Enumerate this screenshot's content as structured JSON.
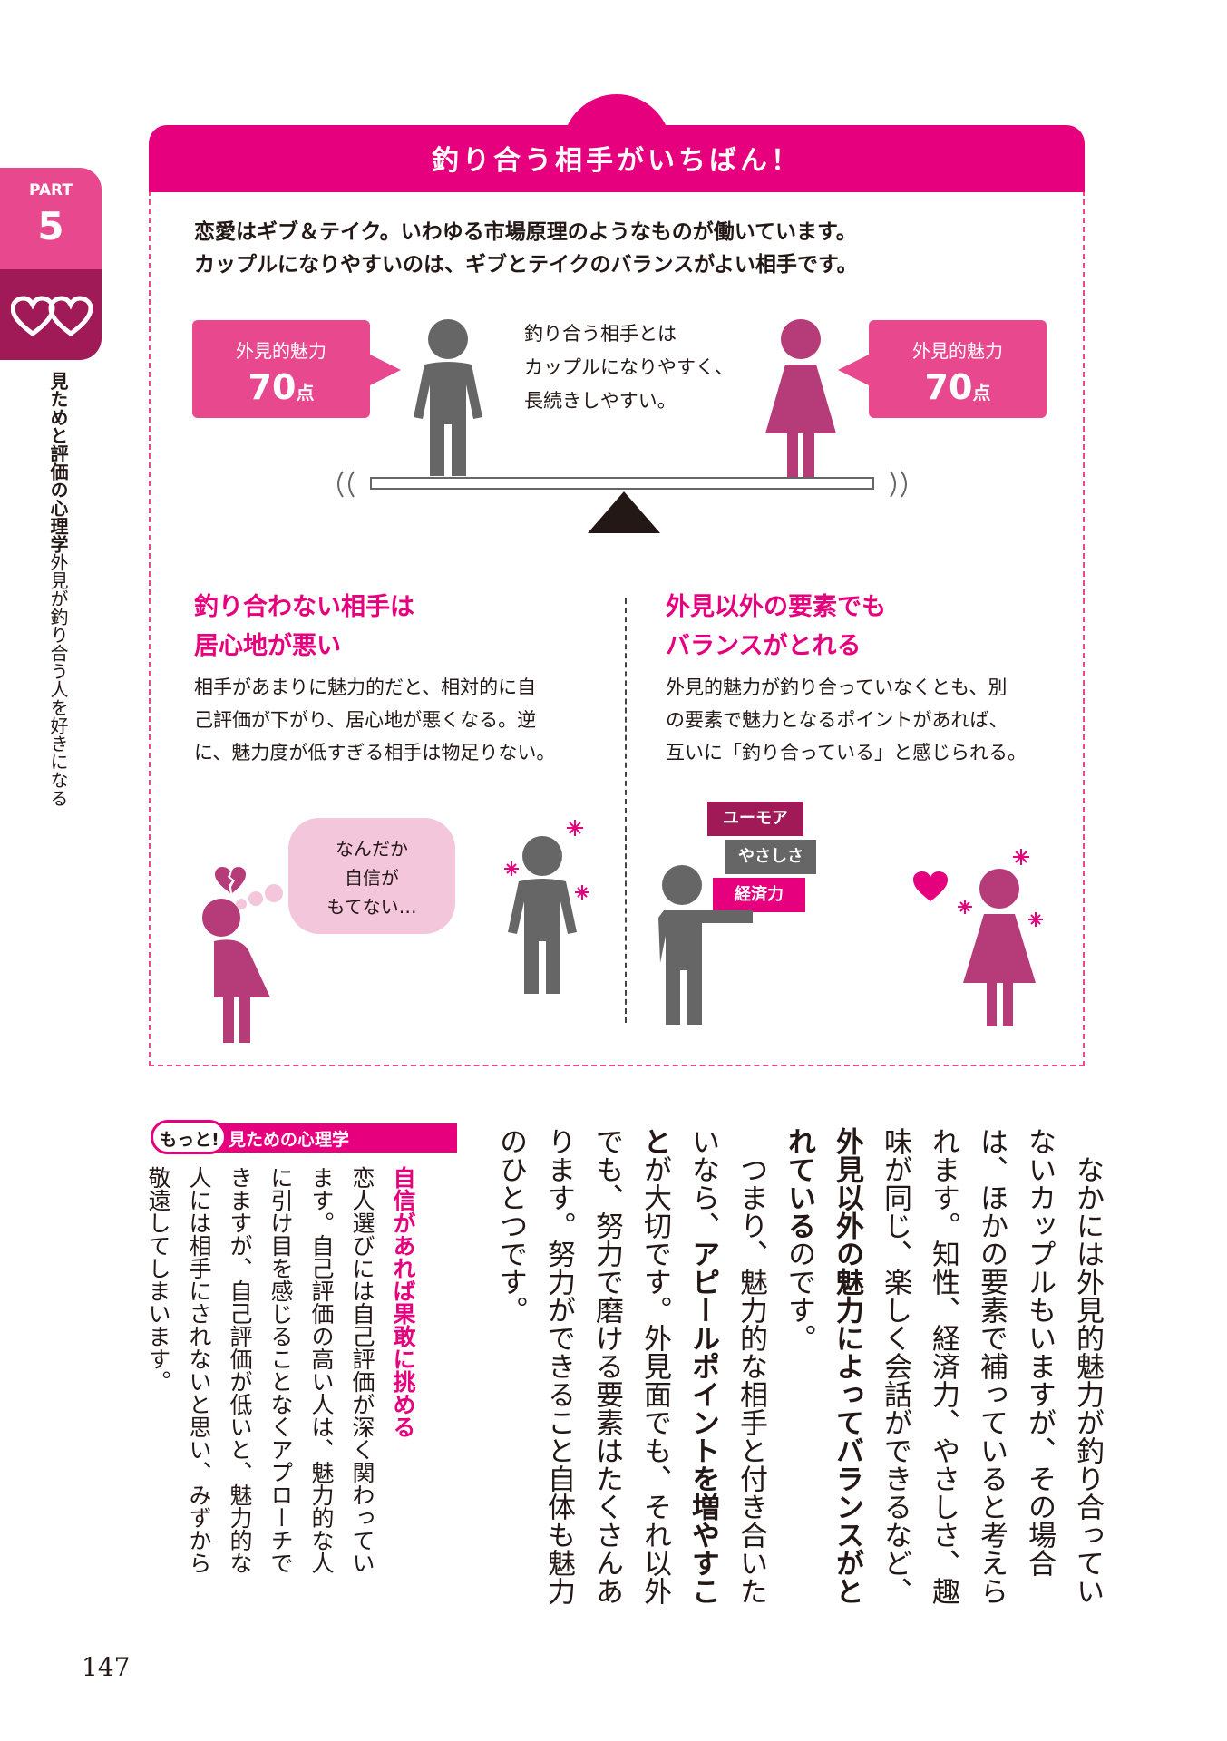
{
  "side": {
    "part_label": "PART",
    "part_number": "5",
    "title_bold": "見ためと評価の心理学",
    "title_sub": "外見が釣り合う人を好きになる"
  },
  "box": {
    "title": "釣り合う相手がいちばん！",
    "intro_line1": "恋愛はギブ＆テイク。いわゆる市場原理のようなものが働いています。",
    "intro_line2": "カップルになりやすいのは、ギブとテイクのバランスがよい相手です。",
    "left_callout_label": "外見的魅力",
    "left_callout_value": "70",
    "left_callout_unit": "点",
    "right_callout_label": "外見的魅力",
    "right_callout_value": "70",
    "right_callout_unit": "点",
    "center_line1": "釣り合う相手とは",
    "center_line2": "カップルになりやすく、",
    "center_line3": "長続きしやすい。",
    "left_head_line1": "釣り合わない相手は",
    "left_head_line2": "居心地が悪い",
    "left_body_line1": "相手があまりに魅力的だと、相対的に自",
    "left_body_line2": "己評価が下がり、居心地が悪くなる。逆",
    "left_body_line3": "に、魅力度が低すぎる相手は物足りない。",
    "right_head_line1": "外見以外の要素でも",
    "right_head_line2": "バランスがとれる",
    "right_body_line1": "外見的魅力が釣り合っていなくとも、別",
    "right_body_line2": "の要素で魅力となるポイントがあれば、",
    "right_body_line3": "互いに「釣り合っている」と感じられる。",
    "speech_line1": "なんだか",
    "speech_line2": "自信が",
    "speech_line3": "もてない…",
    "tag1": "ユーモア",
    "tag2": "やさしさ",
    "tag3": "経済力"
  },
  "motto": {
    "bubble": "もっと!",
    "title": "見ための心理学",
    "heading": "自信があれば果敢に挑める",
    "body": "恋人選びには自己評価が深く関わっています。自己評価の高い人は、魅力的な人に引け目を感じることなくアプローチできますが、自己評価が低いと、魅力的な人には相手にされないと思い、みずから敬遠してしまいます。"
  },
  "main_text": {
    "p1_a": "なかには外見的魅力が釣り合っていないカップルもいますが、その場合は、ほかの要素で補っていると考えられます。知性、経済力、やさしさ、趣味が同じ、楽しく会話ができるなど、",
    "p1_b": "外見以外の魅力によってバランスがとれている",
    "p1_c": "のです。",
    "p2_a": "つまり、魅力的な相手と付き合いたいなら、",
    "p2_b": "アピールポイントを増やすこと",
    "p2_c": "が大切です。外見面でも、それ以外でも、努力で磨ける要素はたくさんあります。努力ができること自体も魅力のひとつです。"
  },
  "page_number": "147",
  "colors": {
    "pink": "#e6007e",
    "light_pink": "#e8488d",
    "dark_pink": "#a11a58",
    "gray": "#666666",
    "figure_pink": "#b53b79"
  }
}
